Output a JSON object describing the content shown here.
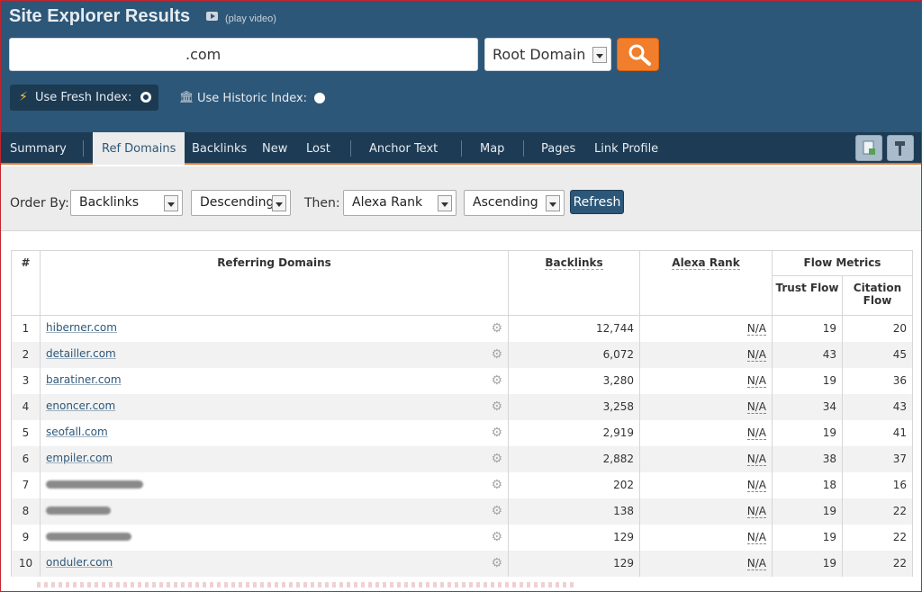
{
  "header": {
    "title": "Site Explorer Results",
    "video_text": "(play video)",
    "url_suffix": ".com",
    "scope": "Root Domain",
    "fresh_label": "Use Fresh Index:",
    "historic_label": "Use Historic Index:"
  },
  "nav": {
    "items": [
      "Summary",
      "Ref Domains",
      "Backlinks",
      "New",
      "Lost",
      "Anchor Text",
      "Map",
      "Pages",
      "Link Profile"
    ],
    "active": "Ref Domains"
  },
  "order": {
    "order_by_label": "Order By:",
    "order_by": "Backlinks",
    "order_dir": "Descending",
    "then_label": "Then:",
    "then_by": "Alexa Rank",
    "then_dir": "Ascending",
    "refresh_label": "Refresh"
  },
  "table": {
    "headers": {
      "num": "#",
      "domains": "Referring Domains",
      "backlinks": "Backlinks",
      "alexa": "Alexa Rank",
      "flow": "Flow Metrics",
      "trust": "Trust Flow",
      "citation": "Citation Flow"
    },
    "rows": [
      {
        "n": "1",
        "domain": "hiberner.com",
        "backlinks": "12,744",
        "alexa": "N/A",
        "trust": "19",
        "citation": "20"
      },
      {
        "n": "2",
        "domain": "detailler.com",
        "backlinks": "6,072",
        "alexa": "N/A",
        "trust": "43",
        "citation": "45"
      },
      {
        "n": "3",
        "domain": "baratiner.com",
        "backlinks": "3,280",
        "alexa": "N/A",
        "trust": "19",
        "citation": "36"
      },
      {
        "n": "4",
        "domain": "enoncer.com",
        "backlinks": "3,258",
        "alexa": "N/A",
        "trust": "34",
        "citation": "43"
      },
      {
        "n": "5",
        "domain": "seofall.com",
        "backlinks": "2,919",
        "alexa": "N/A",
        "trust": "19",
        "citation": "41"
      },
      {
        "n": "6",
        "domain": "empiler.com",
        "backlinks": "2,882",
        "alexa": "N/A",
        "trust": "38",
        "citation": "37"
      },
      {
        "n": "7",
        "domain": "",
        "backlinks": "202",
        "alexa": "N/A",
        "trust": "18",
        "citation": "16"
      },
      {
        "n": "8",
        "domain": "",
        "backlinks": "138",
        "alexa": "N/A",
        "trust": "19",
        "citation": "22"
      },
      {
        "n": "9",
        "domain": "",
        "backlinks": "129",
        "alexa": "N/A",
        "trust": "19",
        "citation": "22"
      },
      {
        "n": "10",
        "domain": "onduler.com",
        "backlinks": "129",
        "alexa": "N/A",
        "trust": "19",
        "citation": "22"
      }
    ]
  }
}
